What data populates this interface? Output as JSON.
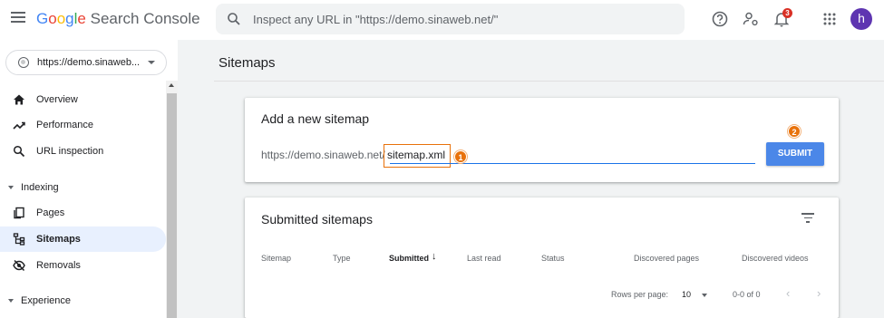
{
  "header": {
    "logo_google": [
      "G",
      "o",
      "o",
      "g",
      "l",
      "e"
    ],
    "logo_product": "Search Console",
    "inspect_placeholder": "Inspect any URL in \"https://demo.sinaweb.net/\"",
    "notification_count": "3",
    "avatar_letter": "h"
  },
  "property": {
    "label": "https://demo.sinaweb..."
  },
  "sidebar": {
    "items": [
      {
        "label": "Overview",
        "icon": "home-icon"
      },
      {
        "label": "Performance",
        "icon": "trending-up-icon"
      },
      {
        "label": "URL inspection",
        "icon": "search-icon"
      }
    ],
    "sections": [
      {
        "label": "Indexing"
      },
      {
        "label": "Experience"
      }
    ],
    "indexing_items": [
      {
        "label": "Pages",
        "icon": "pages-icon"
      },
      {
        "label": "Sitemaps",
        "icon": "sitemap-icon",
        "active": true
      },
      {
        "label": "Removals",
        "icon": "removals-icon"
      }
    ]
  },
  "main": {
    "title": "Sitemaps",
    "add_card": {
      "title": "Add a new sitemap",
      "prefix": "https://demo.sinaweb.net/",
      "input_value": "sitemap.xml",
      "submit_label": "SUBMIT",
      "marker1": "1",
      "marker2": "2"
    },
    "submitted_card": {
      "title": "Submitted sitemaps",
      "columns": [
        "Sitemap",
        "Type",
        "Submitted",
        "Last read",
        "Status",
        "Discovered pages",
        "Discovered videos"
      ],
      "rows_per_page_label": "Rows per page:",
      "rows_per_page_value": "10",
      "range": "0-0 of 0"
    }
  },
  "colors": {
    "accent": "#1a73e8",
    "highlight": "#e8710a",
    "submit": "#4b87e8",
    "active_nav": "#e8f0fe"
  }
}
